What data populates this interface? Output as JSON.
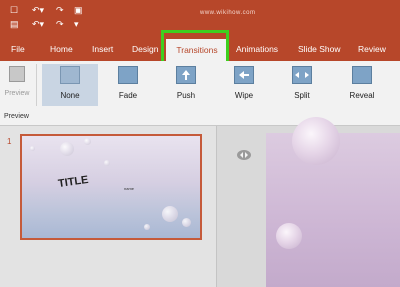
{
  "watermark": "www.wikihow.com",
  "qat": {
    "icons": [
      "window-icon",
      "undo-icon",
      "redo-icon",
      "present-icon",
      "save-icon",
      "undo-icon",
      "redo-icon",
      "customize-icon"
    ],
    "glyphs": [
      "☐",
      "↶",
      "↷",
      "▣",
      "▤",
      "↶",
      "↷",
      "▾"
    ]
  },
  "tabs": {
    "file": "File",
    "home": "Home",
    "insert": "Insert",
    "design": "Design",
    "transitions": "Transitions",
    "animations": "Animations",
    "slideshow": "Slide Show",
    "review": "Review"
  },
  "ribbon": {
    "preview": "Preview",
    "none": "None",
    "fade": "Fade",
    "push": "Push",
    "wipe": "Wipe",
    "split": "Split",
    "reveal": "Reveal"
  },
  "group_label": "Preview",
  "slides_pane": {
    "slide_number": "1",
    "title": "TITLE",
    "subtitle": "name"
  },
  "colors": {
    "brand": "#b7472a",
    "highlight": "#3ecf1f"
  }
}
